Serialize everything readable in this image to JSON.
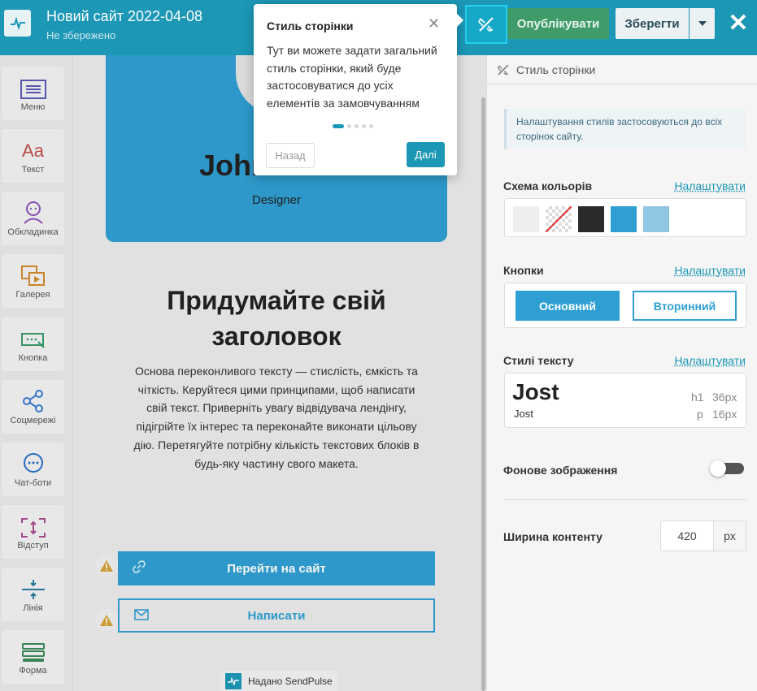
{
  "header": {
    "title": "Новий сайт 2022-04-08",
    "status": "Не збережено",
    "publish_label": "Опублікувати",
    "save_label": "Зберегти",
    "close_icon": "close-icon",
    "accent_color": "#1c97b6"
  },
  "sidebar": {
    "items": [
      {
        "label": "Меню",
        "icon": "menu-icon"
      },
      {
        "label": "Текст",
        "icon": "text-icon"
      },
      {
        "label": "Обкладинка",
        "icon": "cover-icon"
      },
      {
        "label": "Галерея",
        "icon": "gallery-icon"
      },
      {
        "label": "Кнопка",
        "icon": "button-icon"
      },
      {
        "label": "Соцмережі",
        "icon": "share-icon"
      },
      {
        "label": "Чат-боти",
        "icon": "chat-icon"
      },
      {
        "label": "Відступ",
        "icon": "spacing-icon"
      },
      {
        "label": "Лінія",
        "icon": "divider-icon"
      },
      {
        "label": "Форма",
        "icon": "form-icon"
      }
    ]
  },
  "canvas": {
    "hero_name": "John",
    "hero_role": "Designer",
    "heading": "Придумайте свій заголовок",
    "body": "Основа переконливого тексту — стислість, ємкість та чіткість. Керуйтеся цими принципами, щоб написати свій текст. Приверніть увагу відвідувача лендінгу, підігрійте їх інтерес та переконайте виконати цільову дію. Перетягуйте потрібну кількість текстових блоків в будь-яку частину свого макета.",
    "button_primary": "Перейти на сайт",
    "button_secondary": "Написати",
    "footer": "Надано SendPulse"
  },
  "panel": {
    "title": "Стиль сторінки",
    "note": "Налаштування стилів застосовуються до всіх сторінок сайту.",
    "color_scheme_label": "Схема кольорів",
    "buttons_label": "Кнопки",
    "text_styles_label": "Стилі тексту",
    "configure_link": "Налаштувати",
    "colors": [
      "#eeeeee",
      "transparent",
      "#2b2b2b",
      "#2f9fd2",
      "#8fc6e4"
    ],
    "button_main": "Основний",
    "button_secondary": "Вторинний",
    "heading_font": "Jost",
    "body_font": "Jost",
    "h1_tag": "h1",
    "h1_size": "36px",
    "p_tag": "p",
    "p_size": "16px",
    "bg_image_label": "Фонове зображення",
    "bg_image_enabled": false,
    "content_width_label": "Ширина контенту",
    "content_width_value": "420",
    "content_width_unit": "px"
  },
  "popover": {
    "title": "Стиль сторінки",
    "text": "Тут ви можете задати загальний стиль сторінки, який буде застосовуватися до усіх елементів за замовчуванням",
    "back_label": "Назад",
    "next_label": "Далі",
    "step": 1,
    "total_steps": 5
  }
}
